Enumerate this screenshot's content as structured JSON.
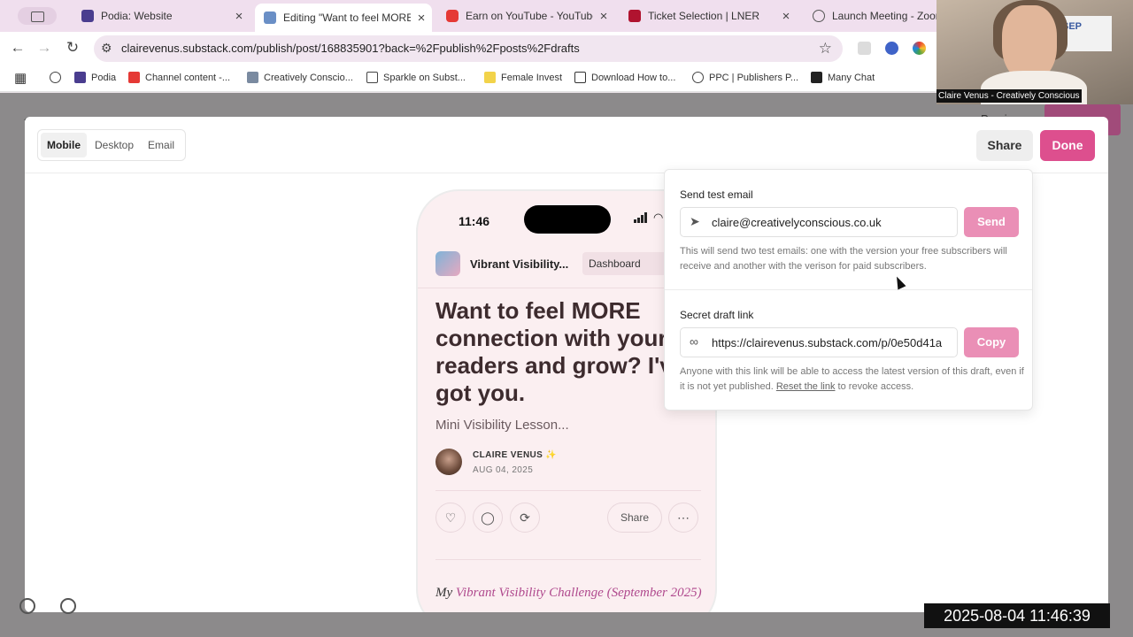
{
  "browser": {
    "tabs": [
      {
        "title": "Podia: Website",
        "favicon_color": "#4a3d8f"
      },
      {
        "title": "Editing \"Want to feel MORE c",
        "favicon_color": "#6a8fc6"
      },
      {
        "title": "Earn on YouTube - YouTube S",
        "favicon_color": "#e53935"
      },
      {
        "title": "Ticket Selection | LNER",
        "favicon_color": "#b0132f"
      },
      {
        "title": "Launch Meeting - Zoom",
        "favicon_color": "#555555"
      }
    ],
    "url": "clairevenus.substack.com/publish/post/168835901?back=%2Fpublish%2Fposts%2Fdrafts",
    "bookmarks": [
      {
        "label": "Podia",
        "color": "#4a3d8f"
      },
      {
        "label": "Channel content -...",
        "color": "#e53935"
      },
      {
        "label": "Creatively Conscio...",
        "color": "#7a8aa0"
      },
      {
        "label": "Sparkle on Subst...",
        "color": "#ffffff"
      },
      {
        "label": "Female Invest",
        "color": "#f2d34a"
      },
      {
        "label": "Download How to...",
        "color": "#333333"
      },
      {
        "label": "PPC | Publishers P...",
        "color": "#555555"
      },
      {
        "label": "Many Chat",
        "color": "#222222"
      }
    ]
  },
  "behind": {
    "preview_label": "Preview"
  },
  "modal": {
    "tabs": [
      "Mobile",
      "Desktop",
      "Email"
    ],
    "selected_tab": "Mobile",
    "share_label": "Share",
    "done_label": "Done"
  },
  "phone": {
    "time": "11:46",
    "publication": "Vibrant Visibility...",
    "dashboard_label": "Dashboard",
    "headline": "Want to feel MORE connection with your readers and grow? I've got you.",
    "subtitle": "Mini Visibility Lesson...",
    "author": "CLAIRE VENUS ✨",
    "date": "AUG 04, 2025",
    "share_label": "Share",
    "body_prefix": "My ",
    "body_link": "Vibrant Visibility Challenge (September 2025)"
  },
  "share_popover": {
    "test_email": {
      "label": "Send test email",
      "value": "claire@creativelyconscious.co.uk",
      "button": "Send",
      "help": "This will send two test emails: one with the version your free subscribers will receive and another with the verison for paid subscribers."
    },
    "draft_link": {
      "label": "Secret draft link",
      "value": "https://clairevenus.substack.com/p/0e50d41a",
      "button": "Copy",
      "help_before": "Anyone with this link will be able to access the latest version of this draft, even if it is not yet published. ",
      "help_link": "Reset the link",
      "help_after": " to revoke access."
    }
  },
  "video": {
    "caption": "Claire Venus - Creatively Conscious",
    "sign_text": "SEP"
  },
  "timestamp": "2025-08-04 11:46:39"
}
